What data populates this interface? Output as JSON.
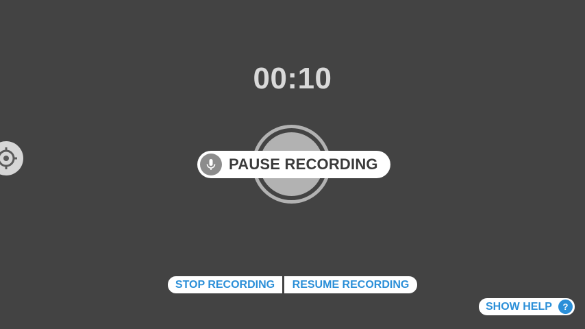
{
  "timer": {
    "elapsed": "00:10"
  },
  "controls": {
    "pause_label": "PAUSE RECORDING",
    "stop_label": "STOP RECORDING",
    "resume_label": "RESUME RECORDING",
    "help_label": "SHOW HELP",
    "help_icon_glyph": "?"
  },
  "icons": {
    "mic": "microphone-icon",
    "crosshair": "crosshair-icon",
    "help": "question-icon"
  },
  "colors": {
    "background": "#434343",
    "accent": "#2b8fd8",
    "record_button": "#b2b2b2",
    "timer_text": "#d9d9d9"
  }
}
